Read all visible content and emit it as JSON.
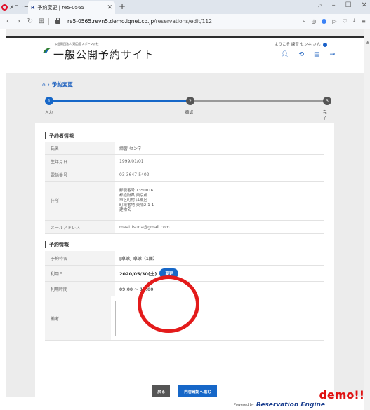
{
  "browser": {
    "menu_label": "メニュー",
    "tab_favicon": "R",
    "tab_title": "予約変更 | re5-0565",
    "url_host": "re5-0565.revn5.demo.iqnet.co.jp",
    "url_path": "/reservations/edit/112"
  },
  "header": {
    "org_small": "公益財団法人 東区館 スポーツ公社",
    "site_title": "一般公開予約サイト",
    "welcome": "ようこそ 練習 センネ さん"
  },
  "breadcrumb": {
    "home_sep": "›",
    "current": "予約変更"
  },
  "steps": [
    {
      "num": "1",
      "label": "入力"
    },
    {
      "num": "2",
      "label": "確認"
    },
    {
      "num": "3",
      "label": "完了"
    }
  ],
  "reserver": {
    "section_title": "予約者情報",
    "rows": [
      {
        "label": "氏名",
        "value": "練習 センネ"
      },
      {
        "label": "生年月日",
        "value": "1999/01/01"
      },
      {
        "label": "電話番号",
        "value": "03-3647-5402"
      },
      {
        "label": "メールアドレス",
        "value": "meat.tsuda@gmail.com"
      }
    ],
    "address_label": "住所",
    "address_lines": [
      "郵便番号 1350016",
      "都道府県 東京都",
      "市区町村 江東区",
      "町域番地 東陽2-1-1",
      "建物名"
    ]
  },
  "reservation": {
    "section_title": "予約情報",
    "rows": [
      {
        "label": "予約枠名",
        "value": "[卓球] 卓球（1面）"
      },
      {
        "label": "利用日",
        "value": "2020/05/30(土)"
      },
      {
        "label": "利用時間",
        "value": "09:00 ～ 12:00"
      }
    ],
    "change_button": "変更",
    "memo_label": "備考"
  },
  "actions": {
    "back": "戻る",
    "confirm": "内容確認へ進む"
  },
  "footer": {
    "powered_by": "Powered by",
    "brand": "Reservation Engine",
    "demo": "demo!!"
  },
  "colors": {
    "accent": "#1667c8",
    "annotation": "#e31b1b",
    "step_inactive": "#555555"
  }
}
